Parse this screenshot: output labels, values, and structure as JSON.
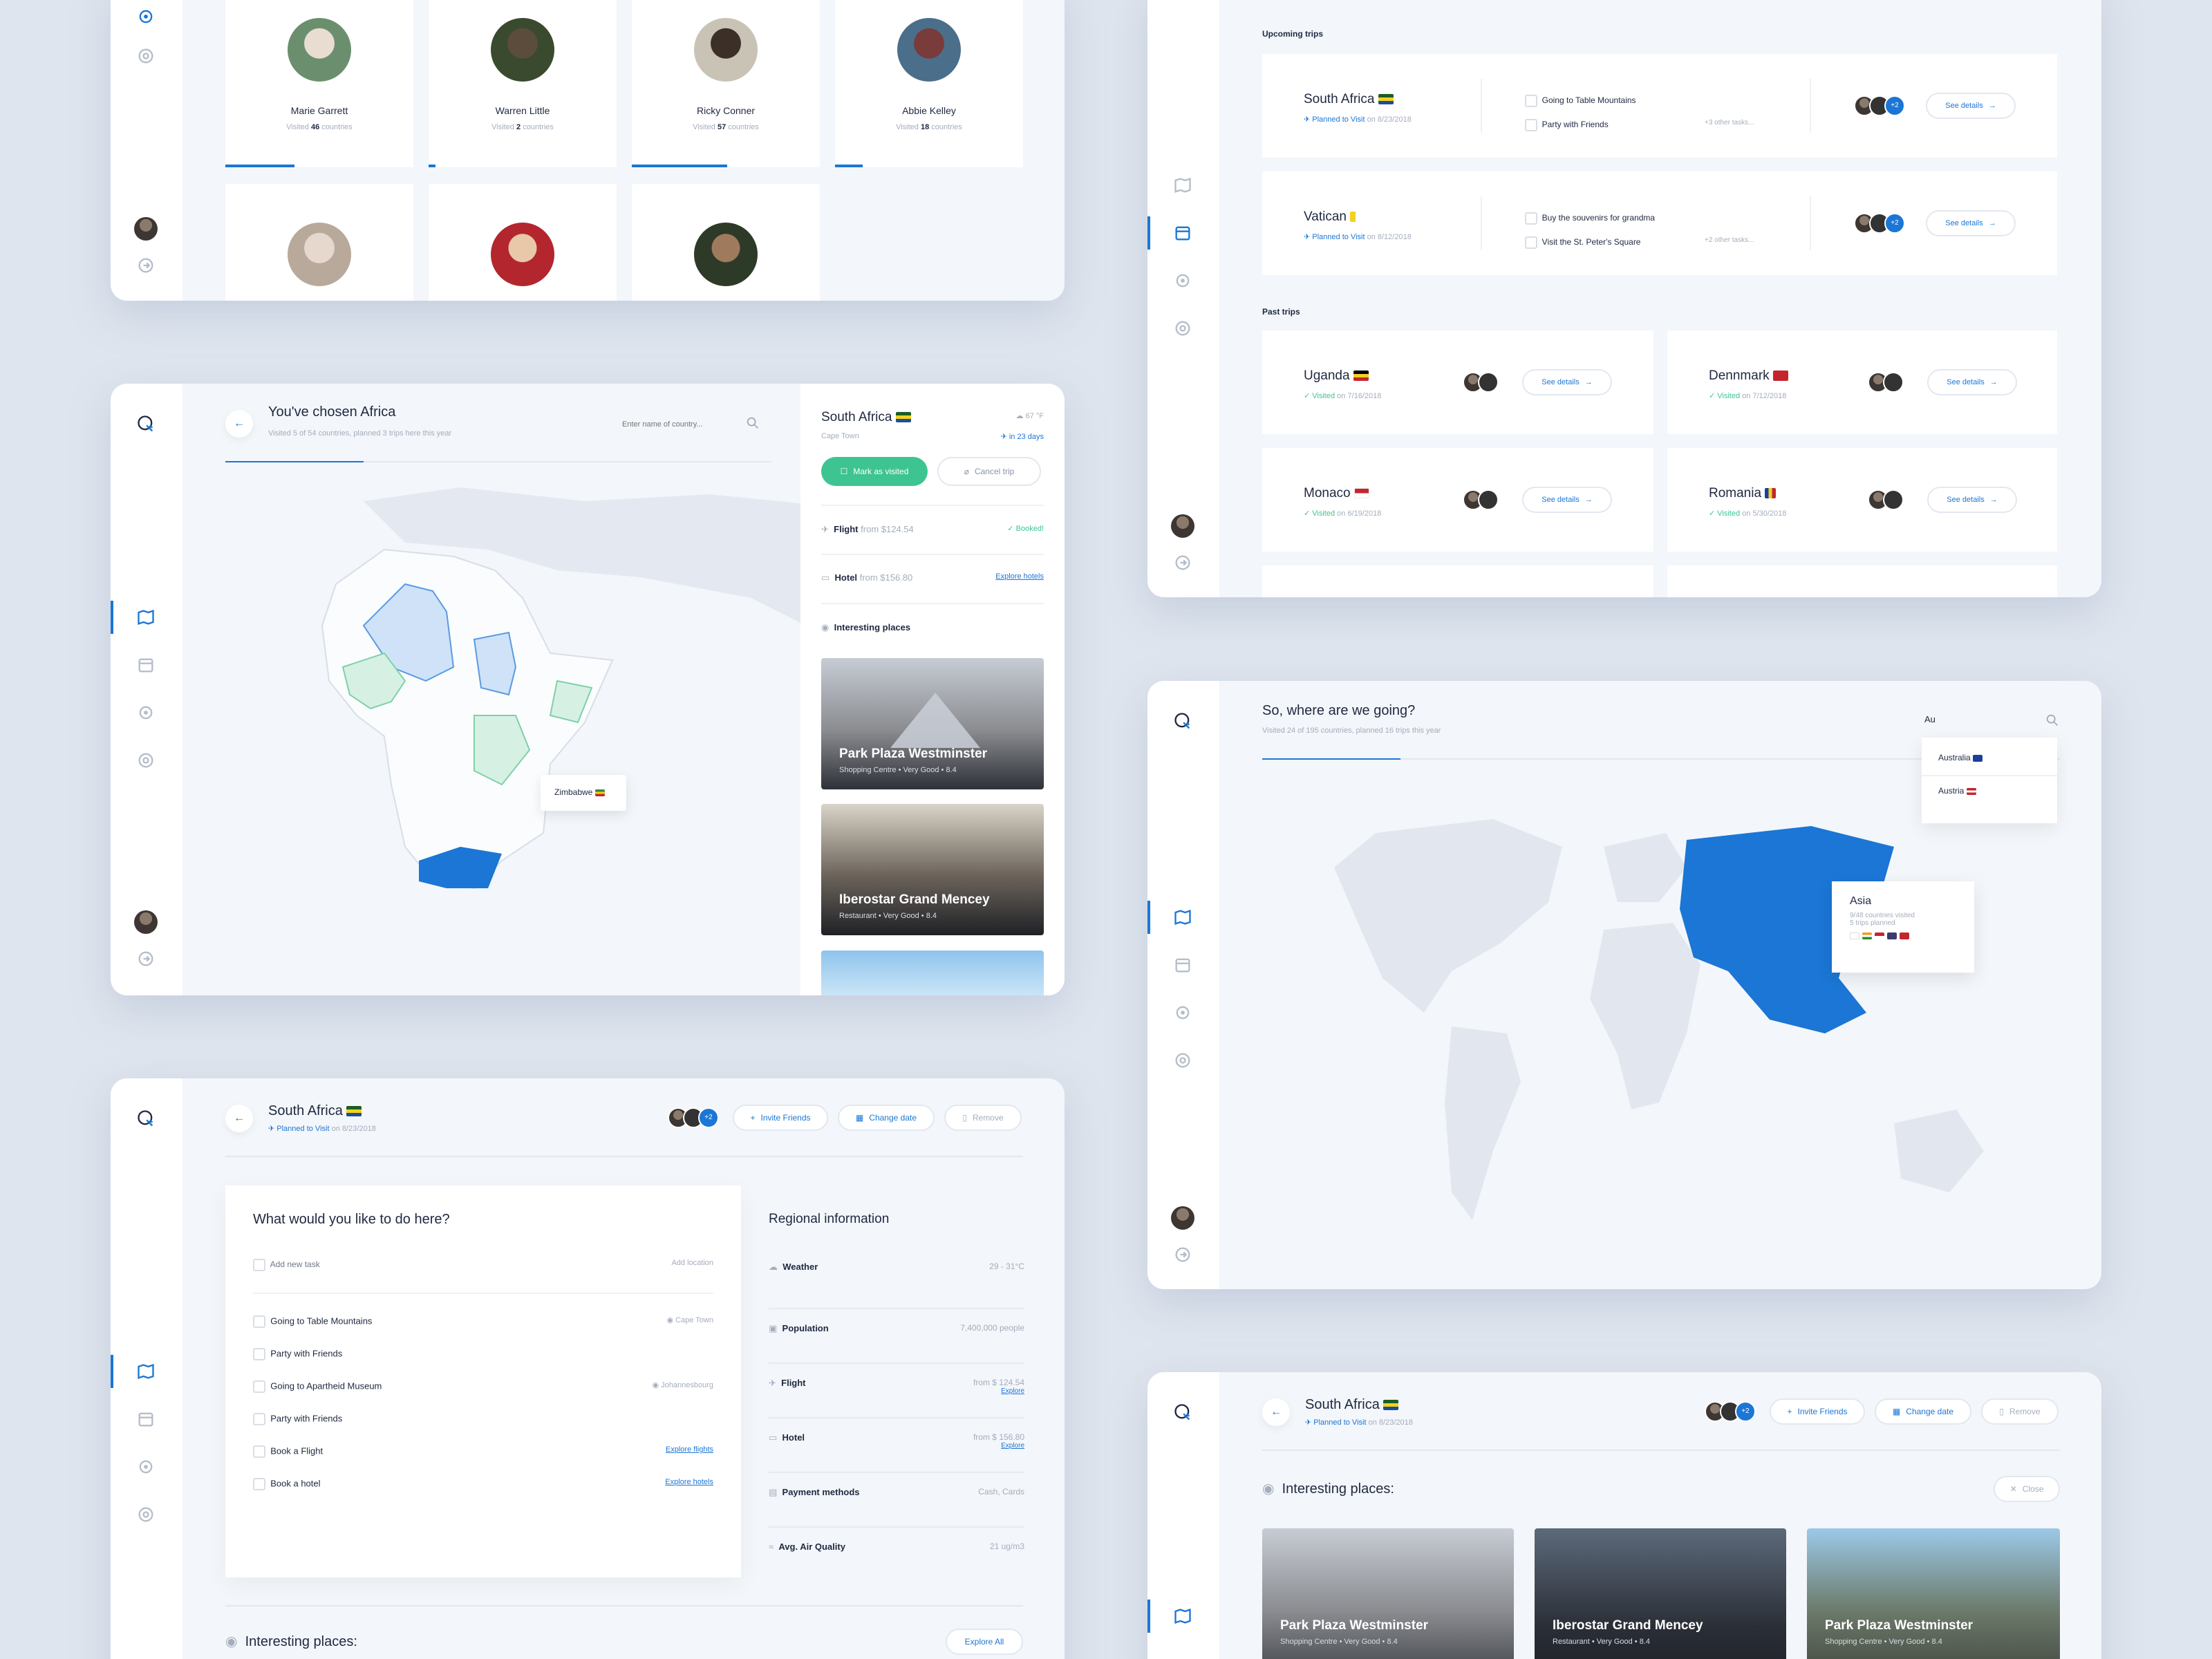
{
  "friends": {
    "people": [
      {
        "name": "Marie Garrett",
        "visited_prefix": "Visited",
        "count": "46",
        "suffix": "countries"
      },
      {
        "name": "Warren Little",
        "visited_prefix": "Visited",
        "count": "2",
        "suffix": "countries"
      },
      {
        "name": "Ricky Conner",
        "visited_prefix": "Visited",
        "count": "57",
        "suffix": "countries"
      },
      {
        "name": "Abbie Kelley",
        "visited_prefix": "Visited",
        "count": "18",
        "suffix": "countries"
      }
    ]
  },
  "africa": {
    "title": "You've chosen Africa",
    "subtitle": "Visited 5 of 54 countries, planned 3 trips here this year",
    "search_placeholder": "Enter name of country...",
    "tooltip": "Zimbabwe",
    "detail": {
      "country": "South Africa",
      "city": "Cape Town",
      "temp": "67 °F",
      "countdown": "in 23 days",
      "mark_visited": "Mark as visited",
      "cancel_trip": "Cancel trip",
      "flight_label": "Flight",
      "flight_price": "from $124.54",
      "flight_status": "Booked!",
      "hotel_label": "Hotel",
      "hotel_price": "from $156.80",
      "hotel_link": "Explore hotels",
      "places_label": "Interesting places",
      "places": [
        {
          "name": "Park Plaza Westminster",
          "meta": "Shopping Centre  •  Very Good  •  8.4"
        },
        {
          "name": "Iberostar Grand Mencey",
          "meta": "Restaurant  •  Very Good  •  8.4"
        }
      ]
    }
  },
  "trip_detail": {
    "country": "South Africa",
    "status": "Planned to Visit",
    "date": "on 8/23/2018",
    "more_avatars": "+2",
    "invite": "Invite Friends",
    "change_date": "Change date",
    "remove": "Remove",
    "tasks_title": "What would you like to do here?",
    "add_task": "Add new task",
    "add_location": "Add location",
    "tasks": [
      {
        "label": "Going to Table Mountains",
        "meta": "Cape Town"
      },
      {
        "label": "Party with Friends",
        "meta": ""
      },
      {
        "label": "Going to Apartheid Museum",
        "meta": "Johannesbourg"
      },
      {
        "label": "Party with Friends",
        "meta": ""
      },
      {
        "label": "Book a Flight",
        "meta": "Explore flights"
      },
      {
        "label": "Book a hotel",
        "meta": "Explore hotels"
      }
    ],
    "regional_title": "Regional information",
    "regional": [
      {
        "label": "Weather",
        "value": "29 - 31°C",
        "link": ""
      },
      {
        "label": "Population",
        "value": "7,400,000 people",
        "link": ""
      },
      {
        "label": "Flight",
        "value": "from $ 124.54",
        "link": "Explore"
      },
      {
        "label": "Hotel",
        "value": "from $ 156.80",
        "link": "Explore"
      },
      {
        "label": "Payment methods",
        "value": "Cash, Cards",
        "link": ""
      },
      {
        "label": "Avg. Air Quality",
        "value": "21 ug/m3",
        "link": ""
      }
    ],
    "places_title": "Interesting places:",
    "explore_all": "Explore All"
  },
  "trips": {
    "upcoming_label": "Upcoming trips",
    "upcoming": [
      {
        "country": "South Africa",
        "status": "Planned to Visit",
        "date": "on 8/23/2018",
        "task1": "Going to Table Mountains",
        "task2": "Party with Friends",
        "more": "+3 other tasks...",
        "btn": "See details",
        "more_avatars": "+2"
      },
      {
        "country": "Vatican",
        "status": "Planned to Visit",
        "date": "on 8/12/2018",
        "task1": "Buy the souvenirs for grandma",
        "task2": "Visit the St. Peter's Square",
        "more": "+2 other tasks...",
        "btn": "See details",
        "more_avatars": "+2"
      }
    ],
    "past_label": "Past trips",
    "past": [
      {
        "country": "Uganda",
        "status": "Visited",
        "date": "on 7/16/2018",
        "btn": "See details"
      },
      {
        "country": "Dennmark",
        "status": "Visited",
        "date": "on 7/12/2018",
        "btn": "See details"
      },
      {
        "country": "Monaco",
        "status": "Visited",
        "date": "on 6/19/2018",
        "btn": "See details"
      },
      {
        "country": "Romania",
        "status": "Visited",
        "date": "on 5/30/2018",
        "btn": "See details"
      }
    ]
  },
  "world": {
    "title": "So, where are we going?",
    "subtitle": "Visited 24 of 195 countries, planned 16 trips this year",
    "search_value": "Au",
    "suggestions": [
      "Australia",
      "Austria"
    ],
    "tooltip_title": "Asia",
    "tooltip_line1": "9/48 countries visited",
    "tooltip_line2": "5 trips planned"
  },
  "places_panel": {
    "country": "South Africa",
    "status": "Planned to Visit",
    "date": "on 8/23/2018",
    "more_avatars": "+2",
    "invite": "Invite Friends",
    "change_date": "Change date",
    "remove": "Remove",
    "title": "Interesting places:",
    "close": "Close",
    "places": [
      {
        "name": "Park Plaza Westminster",
        "meta": "Shopping Centre  •  Very Good  •  8.4"
      },
      {
        "name": "Iberostar Grand Mencey",
        "meta": "Restaurant  •  Very Good  •  8.4"
      },
      {
        "name": "Park Plaza Westminster",
        "meta": "Shopping Centre  •  Very Good  •  8.4"
      }
    ]
  },
  "colors": {
    "accent": "#1b76d6",
    "success": "#3dc491",
    "background": "#dfe5ee"
  }
}
